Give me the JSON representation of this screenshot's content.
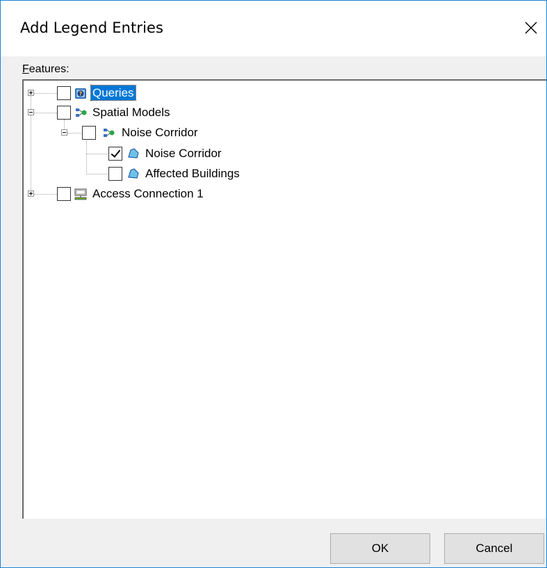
{
  "dialog": {
    "title": "Add Legend Entries",
    "close_symbol": "✕"
  },
  "features_label": {
    "first_letter": "F",
    "rest": "eatures:"
  },
  "tree": {
    "nodes": [
      {
        "label": "Queries",
        "checked": false,
        "expander": "plus",
        "icon": "query-icon",
        "selected": true
      },
      {
        "label": "Spatial Models",
        "checked": false,
        "expander": "minus",
        "icon": "spatial-model-icon",
        "selected": false
      },
      {
        "label": "Noise Corridor",
        "checked": false,
        "expander": "minus",
        "icon": "spatial-model-icon",
        "selected": false
      },
      {
        "label": "Noise Corridor",
        "checked": true,
        "expander": null,
        "icon": "polygon-layer-icon",
        "selected": false
      },
      {
        "label": "Affected Buildings",
        "checked": false,
        "expander": null,
        "icon": "polygon-layer-icon",
        "selected": false
      },
      {
        "label": "Access Connection 1",
        "checked": false,
        "expander": "plus",
        "icon": "database-connection-icon",
        "selected": false
      }
    ]
  },
  "buttons": {
    "ok_label": "OK",
    "cancel_label": "Cancel"
  },
  "colors": {
    "selection": "#0078d7",
    "window_border": "#1883d7",
    "dialog_bg": "#f0f0f0"
  }
}
